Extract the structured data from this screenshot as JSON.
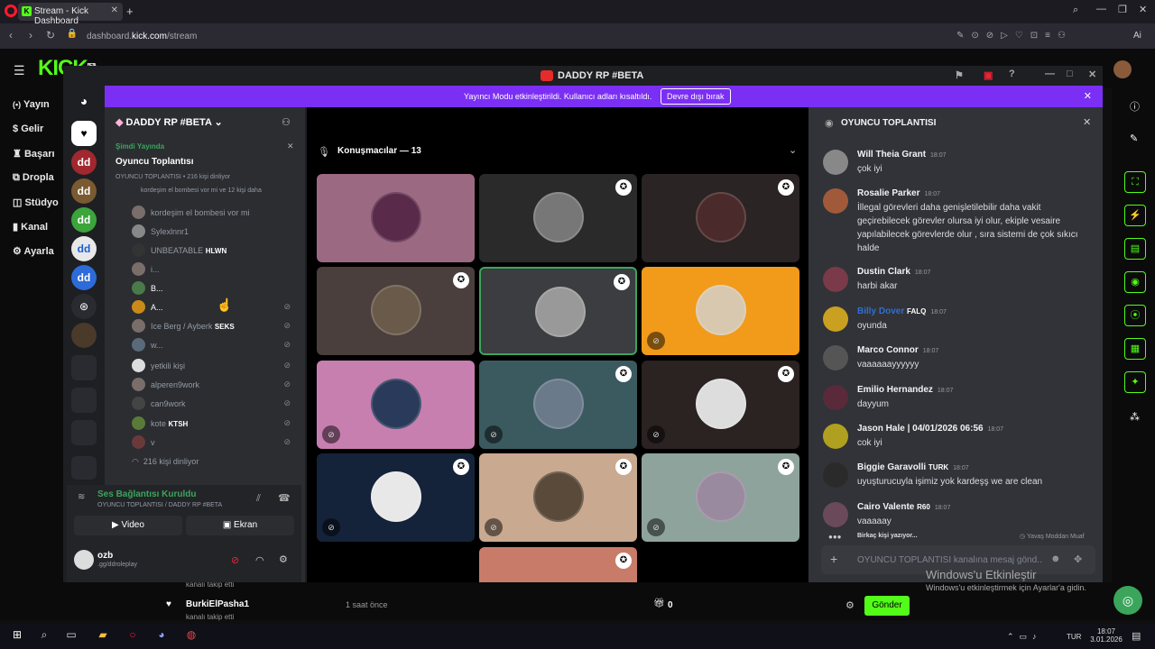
{
  "browser": {
    "tab_title": "Stream - Kick Dashboard",
    "url_prefix": "dashboard.",
    "url_host": "kick.com",
    "url_path": "/stream",
    "ai_label": "Ai"
  },
  "kick": {
    "logo": "KICK",
    "logo_badge": "BETA",
    "sidebar": [
      {
        "icon": "broadcast-icon",
        "label": "Yayın"
      },
      {
        "icon": "dollar-icon",
        "label": "Gelir"
      },
      {
        "icon": "trophy-icon",
        "label": "Başarı"
      },
      {
        "icon": "drop-icon",
        "label": "Dropla"
      },
      {
        "icon": "studio-icon",
        "label": "Stüdyo"
      },
      {
        "icon": "channel-icon",
        "label": "Kanal"
      },
      {
        "icon": "gear-icon",
        "label": "Ayarla"
      }
    ],
    "followers": [
      {
        "text": "kanalı takip etti",
        "name": ""
      },
      {
        "name": "BurkiElPasha1",
        "time": "1 saat önce",
        "text": "kanalı takip etti"
      }
    ],
    "bottom_count": "0",
    "send_label": "Gönder"
  },
  "discord": {
    "window_title": "DADDY RP #BETA",
    "banner_text": "Yayıncı Modu etkinleştirildi. Kullanıcı adları kısaltıldı.",
    "banner_button": "Devre dışı bırak",
    "server_name": "DADDY RP #BETA",
    "live": {
      "status": "Şimdi Yayında",
      "title": "Oyuncu Toplantısı",
      "subtitle": "OYUNCU TOPLANTISI • 216 kişi dinliyor",
      "listeners_line": "kordeşim el bombesi vor mi ve 12 kişi daha"
    },
    "members": [
      {
        "name": "kordeşim el bombesi vor mi",
        "tag": "",
        "muted": false
      },
      {
        "name": "Sylexlnnr1",
        "tag": "",
        "muted": false
      },
      {
        "name": "UNBEATABLE",
        "tag": "HLWN",
        "muted": false
      },
      {
        "name": "i...",
        "tag": "",
        "muted": false
      },
      {
        "name": "B...",
        "tag": "",
        "muted": false
      },
      {
        "name": "A...",
        "tag": "",
        "muted": true
      },
      {
        "name": "Ice Berg / Ayberk",
        "tag": "SEKS",
        "muted": true
      },
      {
        "name": "w...",
        "tag": "",
        "muted": true
      },
      {
        "name": "yetkili kişi",
        "tag": "",
        "muted": true
      },
      {
        "name": "alperen9work",
        "tag": "",
        "muted": true
      },
      {
        "name": "can9work",
        "tag": "",
        "muted": true
      },
      {
        "name": "kote",
        "tag": "KTSH",
        "muted": true
      },
      {
        "name": "v",
        "tag": "",
        "muted": true
      }
    ],
    "listeners_total": "216 kişi dinliyor",
    "voice": {
      "status": "Ses Bağlantısı Kuruldu",
      "channel": "OYUNCU TOPLANTISI / DADDY RP #BETA",
      "video_label": "Video",
      "screen_label": "Ekran"
    },
    "user": {
      "name": "ozb",
      "status": ".gg/ddroleplay"
    },
    "stage": {
      "speakers_label": "Konuşmacılar — 13",
      "tiles": [
        {
          "bg": "#9b6a82",
          "badge": false,
          "muted": false
        },
        {
          "bg": "#2a2a2a",
          "badge": true,
          "muted": false
        },
        {
          "bg": "#2a2424",
          "badge": true,
          "muted": false
        },
        {
          "bg": "#4a3f3c",
          "badge": true,
          "muted": false
        },
        {
          "bg": "#3b3d40",
          "badge": true,
          "muted": false
        },
        {
          "bg": "#f29a1a",
          "badge": false,
          "muted": true
        },
        {
          "bg": "#c77fb0",
          "badge": false,
          "muted": true
        },
        {
          "bg": "#3a5a60",
          "badge": true,
          "muted": true
        },
        {
          "bg": "#2b2222",
          "badge": true,
          "muted": true
        },
        {
          "bg": "#14233a",
          "badge": true,
          "muted": true
        },
        {
          "bg": "#c9a990",
          "badge": true,
          "muted": true
        },
        {
          "bg": "#8fa39d",
          "badge": true,
          "muted": true
        },
        {
          "bg": "#c97b6a",
          "badge": true,
          "muted": false
        }
      ]
    },
    "chat": {
      "title": "OYUNCU TOPLANTISI",
      "messages": [
        {
          "name": "Will Theia Grant",
          "time": "18:07",
          "text": "çok iyi",
          "color": "#f2f3f5"
        },
        {
          "name": "Rosalie Parker",
          "time": "18:07",
          "text": "İllegal görevleri daha genişletilebilir daha vakit geçirebilecek görevler olursa iyi olur, ekiple vesaire yapılabilecek görevlerde olur , sıra sistemi de çok sıkıcı halde",
          "color": "#f2f3f5"
        },
        {
          "name": "Dustin Clark",
          "time": "18:07",
          "text": "harbi akar",
          "color": "#f2f3f5"
        },
        {
          "name": "Billy Dover",
          "tag": "FALQ",
          "time": "18:07",
          "text": "oyunda",
          "color": "#2f6fd1"
        },
        {
          "name": "Marco Connor",
          "time": "18:07",
          "text": "vaaaaaayyyyyy",
          "color": "#f2f3f5"
        },
        {
          "name": "Emilio Hernandez",
          "time": "18:07",
          "text": "dayyum",
          "color": "#f2f3f5"
        },
        {
          "name": "Jason Hale | 04/01/2026 06:56",
          "time": "18:07",
          "text": "cok iyi",
          "color": "#f2f3f5"
        },
        {
          "name": "Biggie Garavolli",
          "tag": "TURK",
          "time": "18:07",
          "text": "uyuşturucuyla işimiz yok kardeşş we are clean",
          "color": "#f2f3f5"
        },
        {
          "name": "Cairo Valente",
          "tag": "R60",
          "time": "18:07",
          "text": "vaaaaay",
          "color": "#f2f3f5"
        }
      ],
      "typing": "Birkaç kişi yazıyor...",
      "slowmode": "Yavaş Moddan Muaf",
      "input_placeholder": "OYUNCU TOPLANTISI kanalına mesaj gönd..."
    }
  },
  "watermark": {
    "title": "Windows'u Etkinleştir",
    "subtitle": "Windows'u etkinleştirmek için Ayarlar'a gidin."
  },
  "taskbar": {
    "lang": "TUR",
    "time": "18:07",
    "date": "3.01.2026"
  }
}
